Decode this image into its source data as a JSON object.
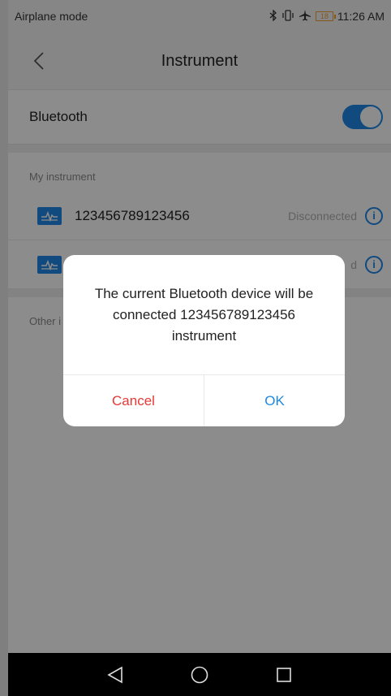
{
  "status_bar": {
    "left_text": "Airplane mode",
    "battery_level": "18",
    "time": "11:26 AM",
    "icons": [
      "bluetooth-icon",
      "vibrate-icon",
      "airplane-icon",
      "battery-icon"
    ]
  },
  "header": {
    "title": "Instrument"
  },
  "bluetooth": {
    "label": "Bluetooth",
    "enabled": true
  },
  "my_instruments": {
    "section_title": "My instrument",
    "items": [
      {
        "name": "123456789123456",
        "status": "Disconnected"
      },
      {
        "name": "",
        "status": "d"
      }
    ]
  },
  "other_instruments": {
    "section_title": "Other i"
  },
  "dialog": {
    "message": "The current Bluetooth device will be connected 123456789123456 instrument",
    "cancel_label": "Cancel",
    "ok_label": "OK"
  },
  "colors": {
    "accent": "#1e88e5",
    "cancel": "#e53935",
    "overlay": "rgba(0,0,0,0.45)"
  }
}
